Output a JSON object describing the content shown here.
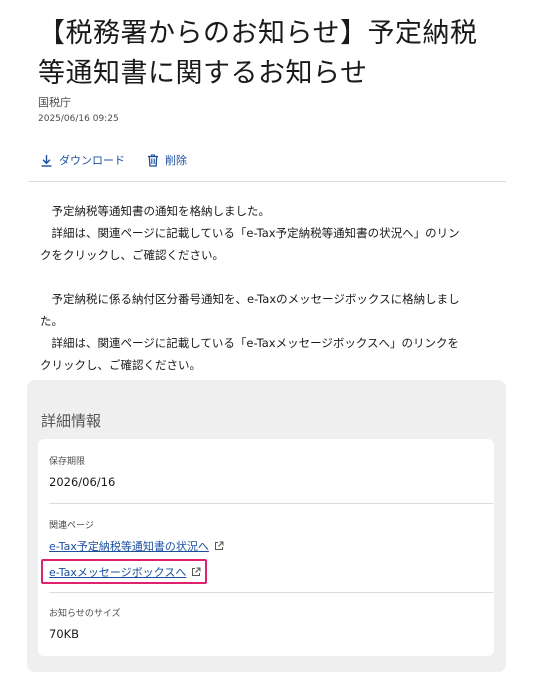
{
  "notice": {
    "title_line1": "【税務署からのお知らせ】予定納税",
    "title_line2": "等通知書に関するお知らせ",
    "sender": "国税庁",
    "timestamp": "2025/06/16 09:25"
  },
  "toolbar": {
    "download_label": "ダウンロード",
    "delete_label": "削除",
    "download_icon": "download-icon",
    "delete_icon": "trash-icon"
  },
  "message": {
    "p1_line1": "　予定納税等通知書の通知を格納しました。",
    "p1_line2": "　詳細は、関連ページに記載している「e-Tax予定納税等通知書の状況へ」のリン",
    "p1_line3": "クをクリックし、ご確認ください。",
    "p2_line1": "　予定納税に係る納付区分番号通知を、e-Taxのメッセージボックスに格納しまし",
    "p2_line2": "た。",
    "p2_line3": "　詳細は、関連ページに記載している「e-Taxメッセージボックスへ」のリンクを",
    "p2_line4": "クリックし、ご確認ください。"
  },
  "details": {
    "heading": "詳細情報",
    "retention_label": "保存期限",
    "retention_value": "2026/06/16",
    "related_label": "関連ページ",
    "link1": "e-Tax予定納税等通知書の状況へ",
    "link2": "e-Taxメッセージボックスへ",
    "size_label": "お知らせのサイズ",
    "size_value": "70KB",
    "link_icon": "external-link-icon"
  },
  "colors": {
    "link": "#1a4fa0",
    "highlight": "#e0226e",
    "card_bg": "#efeff0"
  }
}
